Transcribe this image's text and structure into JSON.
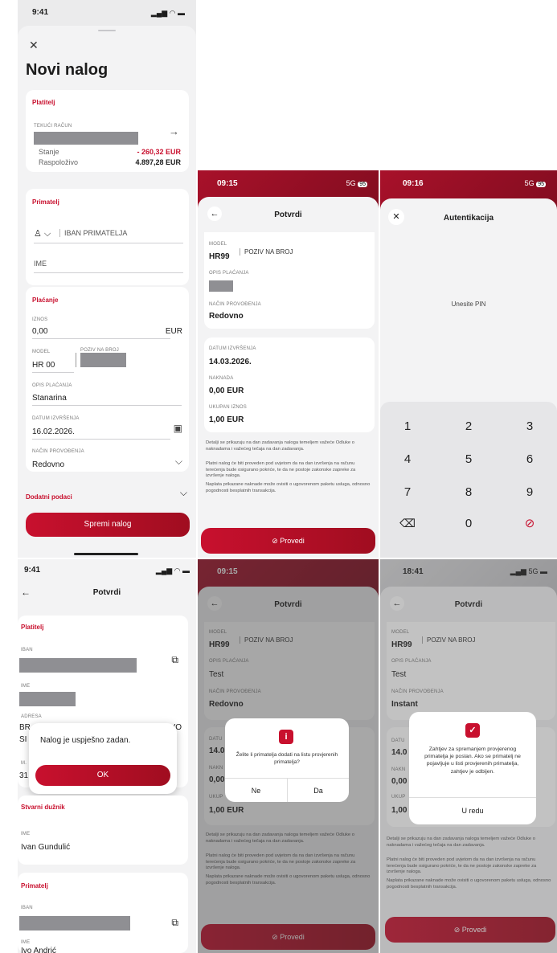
{
  "screen1": {
    "time": "9:41",
    "title": "Novi nalog",
    "payer_section": "Platitelj",
    "account_label": "TEKUĆI RAČUN",
    "balance_label": "Stanje",
    "balance_value": "- 260,32 EUR",
    "available_label": "Raspoloživo",
    "available_value": "4.897,28 EUR",
    "recipient_section": "Primatelj",
    "iban_placeholder": "IBAN PRIMATELJA",
    "name_placeholder": "IME",
    "payment_section": "Plaćanje",
    "amount_label": "IZNOS",
    "amount_value": "0,00",
    "currency": "EUR",
    "model_label": "MODEL",
    "model_value": "HR 00",
    "reference_label": "POZIV NA BROJ",
    "desc_label": "OPIS PLAĆANJA",
    "desc_value": "Stanarina",
    "date_label": "DATUM IZVRŠENJA",
    "date_value": "16.02.2026.",
    "method_label": "NAČIN PROVOĐENJA",
    "method_value": "Redovno",
    "extra_label": "Dodatni podaci",
    "save_button": "Spremi nalog"
  },
  "screen2": {
    "time": "09:15",
    "signal": "5G",
    "battery": "95",
    "title": "Potvrdi",
    "cut_amount": "1,00 EUR",
    "model_label": "MODEL",
    "model_value": "HR99",
    "reference_label": "POZIV NA BROJ",
    "desc_label": "OPIS PLAĆANJA",
    "method_label": "NAČIN PROVOĐENJA",
    "method_value": "Redovno",
    "date_label": "DATUM IZVRŠENJA",
    "date_value": "14.03.2026.",
    "fee_label": "NAKNADA",
    "fee_value": "0,00 EUR",
    "total_label": "UKUPAN IZNOS",
    "total_value": "1,00 EUR",
    "note1": "Detalji se prikazuju na dan zadavanja naloga temeljem važeće Odluke o naknadama i važećeg tečaja na dan zadavanja.",
    "note2": "Platni nalog će biti proveden pod uvjetom da na dan izvršenja na računu terećenja bude osigurano pokriće, te da ne postoje zakonske zapreke za izvršenje naloga.",
    "note3": "Naplata prikazane naknade može ovisiti o ugovorenom paketu usluga, odnosno pogodnosti besplatnih transakcija.",
    "execute_button": "Provedi"
  },
  "screen3": {
    "time": "09:16",
    "signal": "5G",
    "battery": "95",
    "title": "Autentikacija",
    "pin_prompt": "Unesite PIN",
    "keys": [
      "1",
      "2",
      "3",
      "4",
      "5",
      "6",
      "7",
      "8",
      "9",
      "0"
    ]
  },
  "screen4": {
    "time": "9:41",
    "title": "Potvrdi",
    "payer_section": "Platitelj",
    "iban_label": "IBAN",
    "name_label": "IME",
    "address_label": "ADRESA",
    "address_partial_left": "BR",
    "address_partial_right": "VO",
    "address_partial_left2": "SI",
    "ma_label": "M.",
    "ma_value": "31",
    "success_message": "Nalog je uspješno zadan.",
    "ok_button": "OK",
    "debtor_section": "Stvarni dužnik",
    "debtor_name_label": "IME",
    "debtor_name": "Ivan Gundulić",
    "recipient_section": "Primatelj",
    "recipient_iban_label": "IBAN",
    "recipient_name_label": "IME",
    "recipient_name": "Ivo Andrić"
  },
  "screen5": {
    "time": "09:15",
    "title": "Potvrdi",
    "model_label": "MODEL",
    "model_value": "HR99",
    "reference_label": "POZIV NA BROJ",
    "desc_label": "OPIS PLAĆANJA",
    "desc_value": "Test",
    "method_label": "NAČIN PROVOĐENJA",
    "method_value": "Redovno",
    "date_partial": "DATU",
    "date_value_partial": "14.0",
    "fee_partial": "NAKN",
    "fee_value_partial": "0,00",
    "total_partial": "UKUP",
    "total_value": "1,00 EUR",
    "dialog_text": "Želite li primatelja dodati na listu provjerenih primatelja?",
    "no_button": "Ne",
    "yes_button": "Da",
    "note1": "Detalji se prikazuju na dan zadavanja naloga temeljem važeće Odluke o naknadama i važećeg tečaja na dan zadavanja.",
    "note2": "Platni nalog će biti proveden pod uvjetom da na dan izvršenja na računu terećenja bude osigurano pokriće, te da ne postoje zakonske zapreke za izvršenje naloga.",
    "note3": "Naplata prikazane naknade može ovisiti o ugovorenom paketu usluga, odnosno pogodnosti besplatnih transakcija.",
    "execute_button": "Provedi"
  },
  "screen6": {
    "time": "18:41",
    "signal": "5G",
    "title": "Potvrdi",
    "model_label": "MODEL",
    "model_value": "HR99",
    "reference_label": "POZIV NA BROJ",
    "desc_label": "OPIS PLAĆANJA",
    "desc_value": "Test",
    "method_label": "NAČIN PROVOĐENJA",
    "method_value": "Instant",
    "date_partial": "DATU",
    "date_value_partial": "14.0",
    "fee_partial": "NAKN",
    "fee_value_partial": "0,00",
    "total_partial": "UKUP",
    "total_value_partial": "1,00",
    "dialog_text": "Zahtjev za spremanjem provjerenog primatelja je poslan. Ako se primatelj ne pojavljuje u listi provjerenih primatelja, zahtjev je odbijen.",
    "ok_button": "U redu",
    "note1": "Detalji se prikazuju na dan zadavanja naloga temeljem važeće Odluke o naknadama i važećeg tečaja na dan zadavanja.",
    "note2": "Platni nalog će biti proveden pod uvjetom da na dan izvršenja na računu terećenja bude osigurano pokriće, te da ne postoje zakonske zapreke za izvršenje naloga.",
    "note3": "Naplata prikazane naknade može ovisiti o ugovorenom paketu usluga, odnosno pogodnosti besplatnih transakcija.",
    "execute_button": "Provedi"
  },
  "colors": {
    "accent": "#c8102e",
    "background": "#f3f3f4",
    "card": "#ffffff"
  }
}
